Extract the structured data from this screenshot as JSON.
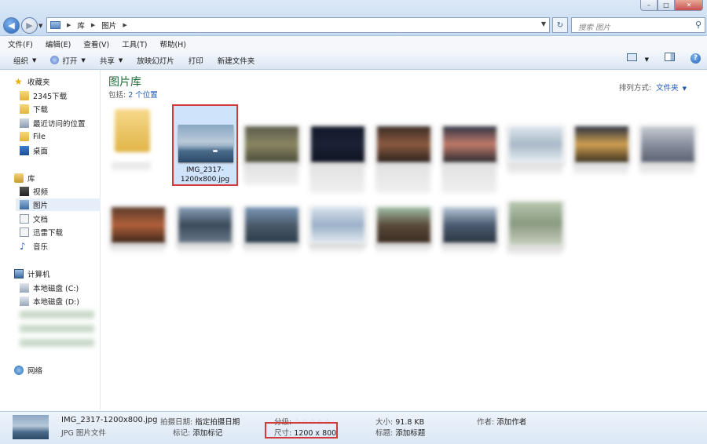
{
  "window": {
    "minimize_glyph": "–",
    "maximize_glyph": "□",
    "close_glyph": "✕"
  },
  "address": {
    "crumbs": [
      "库",
      "图片"
    ],
    "search_placeholder": "搜索 图片"
  },
  "menu": [
    "文件(F)",
    "编辑(E)",
    "查看(V)",
    "工具(T)",
    "帮助(H)"
  ],
  "toolbar": {
    "organize": "组织",
    "open": "打开",
    "share": "共享",
    "slideshow": "放映幻灯片",
    "print": "打印",
    "new_folder": "新建文件夹"
  },
  "nav": {
    "favorites": "收藏夹",
    "fav_items": [
      "2345下载",
      "下载",
      "最近访问的位置",
      "File",
      "桌面"
    ],
    "libraries": "库",
    "lib_items": [
      "视频",
      "图片",
      "文档",
      "迅雷下载",
      "音乐"
    ],
    "computer": "计算机",
    "drives": [
      "本地磁盘 (C:)",
      "本地磁盘 (D:)"
    ],
    "network": "网络"
  },
  "library": {
    "title": "图片库",
    "includes_label": "包括:",
    "locations": "2 个位置",
    "arrange_label": "排列方式:",
    "arrange_value": "文件夹"
  },
  "selected_file": {
    "name": "IMG_2317-1200x800.jpg"
  },
  "details": {
    "file_name": "IMG_2317-1200x800.jpg",
    "file_type": "JPG 图片文件",
    "date_taken_label": "拍摄日期:",
    "date_taken_value": "指定拍摄日期",
    "tags_label": "标记:",
    "tags_value": "添加标记",
    "rating_label": "分级:",
    "dimensions_label": "尺寸:",
    "dimensions_value": "1200 x 800",
    "size_label": "大小:",
    "size_value": "91.8 KB",
    "title_label": "标题:",
    "title_value": "添加标题",
    "author_label": "作者:",
    "author_value": "添加作者"
  },
  "colors": {
    "accent": "#1c57b0",
    "library_title": "#1e6e3a",
    "highlight": "#d33a3a",
    "selected_bg": "#cfe3fb"
  }
}
